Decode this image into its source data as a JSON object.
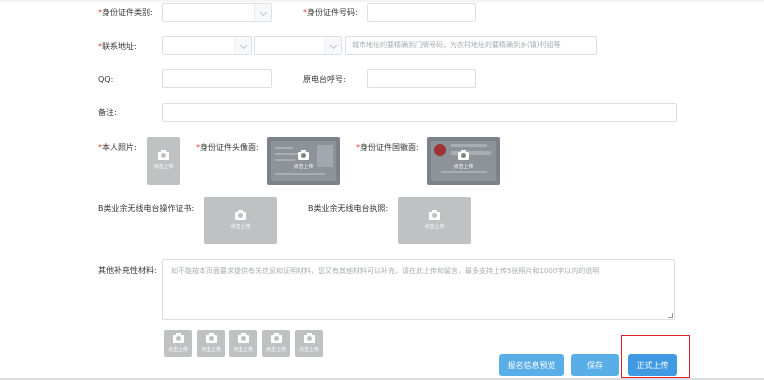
{
  "form": {
    "id_type_label": "身份证件类别:",
    "id_number_label": "身份证件号码:",
    "contact_address_label": "联系地址:",
    "address_placeholder": "城市地址的要精确到门牌号码，为农村地址的要精确到乡(镇)村组等",
    "qq_label": "QQ:",
    "original_callsign_label": "原电台呼号:",
    "remark_label": "备注:",
    "photo_label": "本人照片:",
    "id_front_label": "身份证件头像面:",
    "id_back_label": "身份证件国徽面:",
    "b_cert_label": "B类业余无线电台操作证书:",
    "b_license_label": "B类业余无线电台执照:",
    "supplement_label": "其他补充性材料:",
    "supplement_placeholder": "如不能按本页面要求提供有关信息和证明材料，您又有其他材料可以补充，请在此上传和留言，最多支持上传5张照片和1000字以内的说明",
    "upload_text": "点击上传",
    "required_mark": "*"
  },
  "buttons": {
    "preview": "报名信息预览",
    "save": "保存",
    "submit": "正式上传"
  },
  "colors": {
    "required": "#e53935",
    "button_blue": "#3f9ae3",
    "highlight": "#e02020"
  }
}
